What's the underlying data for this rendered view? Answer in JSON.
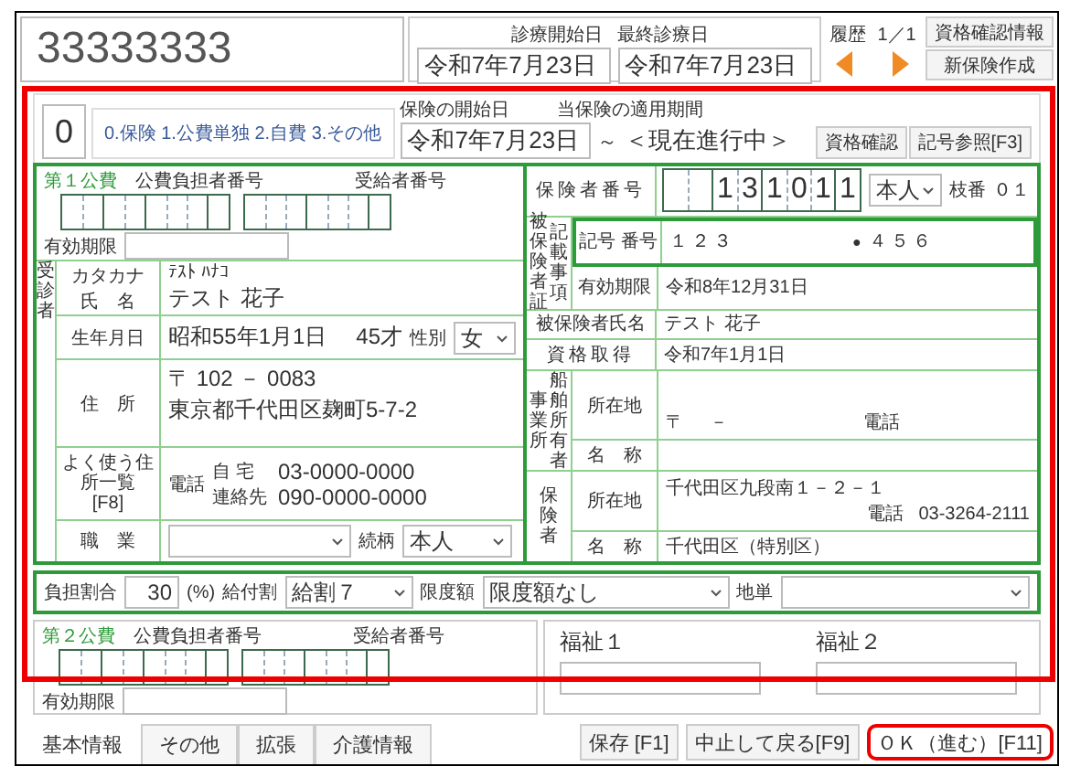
{
  "header": {
    "patient_id": "33333333",
    "first_visit_label": "診療開始日",
    "first_visit": "令和7年7月23日",
    "last_visit_label": "最終診療日",
    "last_visit": "令和7年7月23日",
    "history_label": "履歴",
    "history_page": "1／1",
    "buttons": [
      "資格確認情報",
      "新保険作成"
    ]
  },
  "form": {
    "highlighted": true,
    "type_code": "0",
    "type_options": "0.保険 1.公費単独 2.自費 3.その他",
    "start_label": "保険の開始日",
    "start_date": "令和7年7月23日",
    "period_label": "当保険の適用期間",
    "tilde": "～",
    "period": "＜現在進行中＞",
    "buttons": [
      "資格確認",
      "記号参照[F3]"
    ]
  },
  "public1": {
    "title": "第１公費",
    "payer_label": "公費負担者番号",
    "recipient_label": "受給者番号",
    "expiry_label": "有効期限"
  },
  "patient": {
    "side_label": "受診者",
    "kana_label": "カタカナ",
    "kana": "ﾃｽﾄ ﾊﾅｺ",
    "name_label": "氏　名",
    "name": "テスト 花子",
    "birth_label": "生年月日",
    "birth": "昭和55年1月1日",
    "age": "45才",
    "sex_label": "性別",
    "sex": "女",
    "address_label": "住　所",
    "address_list_label": "よく使う住所一覧",
    "address_list_key": "[F8]",
    "postal": "〒 102 － 0083",
    "address": "東京都千代田区麹町5-7-2",
    "phone_label": "電話",
    "home_label": "自 宅",
    "home": "03-0000-0000",
    "contact_label": "連絡先",
    "contact": "090-0000-0000",
    "job_label": "職　業",
    "relation_label": "続柄",
    "relation": "本人"
  },
  "insurance": {
    "insurer_label": "保険者番号",
    "insurer_digits": [
      "1",
      "3",
      "1",
      "0",
      "1",
      "1"
    ],
    "holder_type": "本人",
    "branch_label": "枝番",
    "branch": "０１",
    "card_labels": [
      "被保険者証",
      "記載事項"
    ],
    "symbol_label": "記号 番号",
    "symbol": "１２３",
    "separator": "●",
    "number": "４５６",
    "expiry_label": "有効期限",
    "expiry": "令和8年12月31日",
    "insured_name_label": "被保険者氏名",
    "insured_name": "テスト 花子",
    "acquired_label": "資格取得",
    "acquired": "令和7年1月1日",
    "employer": {
      "side_labels": [
        "事業所",
        "船舶所有者"
      ],
      "address_label": "所在地",
      "postal": "〒",
      "dash": "－",
      "phone_label": "電話",
      "name_label": "名　称"
    },
    "insurer": {
      "side_label": "保険者",
      "address_label": "所在地",
      "address": "千代田区九段南１－２－１",
      "phone_label": "電話",
      "phone": "03-3264-2111",
      "name_label": "名　称",
      "name": "千代田区（特別区）"
    }
  },
  "burden": {
    "ratio_label": "負担割合",
    "ratio": "30",
    "unit": "(%)",
    "benefit_label": "給付割",
    "benefit": "給割７",
    "limit_label": "限度額",
    "limit": "限度額なし",
    "region_label": "地単"
  },
  "public2": {
    "title": "第２公費",
    "payer_label": "公費負担者番号",
    "recipient_label": "受給者番号",
    "expiry_label": "有効期限"
  },
  "welfare": [
    {
      "label": "福祉１"
    },
    {
      "label": "福祉２"
    }
  ],
  "tabs": [
    {
      "label": "基本情報",
      "selected": true
    },
    {
      "label": "その他",
      "selected": false
    },
    {
      "label": "拡張",
      "selected": false
    },
    {
      "label": "介護情報",
      "selected": false
    }
  ],
  "buttons": [
    {
      "label": "保存 [F1]",
      "highlighted": false
    },
    {
      "label": "中止して戻る[F9]",
      "highlighted": false
    },
    {
      "label": "ＯＫ（進む）[F11]",
      "highlighted": true
    }
  ]
}
